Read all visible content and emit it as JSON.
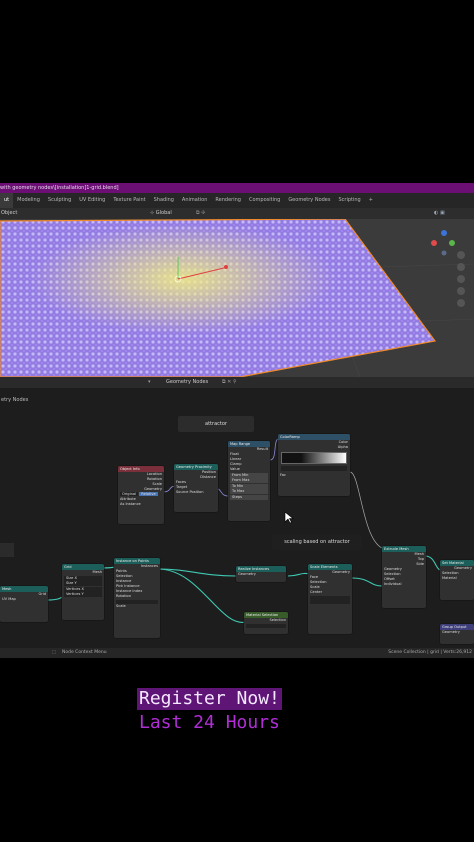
{
  "window": {
    "title": "with geometry nodes\\[installation]1-grid.blend]"
  },
  "tabs": [
    "ut",
    "Modeling",
    "Sculpting",
    "UV Editing",
    "Texture Paint",
    "Shading",
    "Animation",
    "Rendering",
    "Compositing",
    "Geometry Nodes",
    "Scripting",
    "+"
  ],
  "viewport_header": {
    "mode": "Object",
    "transform": "Global"
  },
  "node_editor_header": {
    "editor": "Geometry Nodes"
  },
  "node_tree": {
    "label": "etry Nodes",
    "frames": {
      "attractor": "attractor",
      "scaling": "scaling based on attractor"
    },
    "nodes": {
      "object_info": {
        "title": "Object Info",
        "rows": [
          "Location",
          "Rotation",
          "Scale",
          "Geometry"
        ],
        "buttons": [
          "Original",
          "Relative"
        ],
        "options": [
          "Attribute",
          "As Instance"
        ]
      },
      "geometry_proximity": {
        "title": "Geometry Proximity",
        "rows": [
          "Position",
          "Distance",
          "Faces",
          "Target",
          "Source Position"
        ]
      },
      "map_range": {
        "title": "Map Range",
        "rows": [
          "Result",
          "Float",
          "Linear",
          "Clamp",
          "Value"
        ],
        "fields": [
          "From Min",
          "From Max",
          "To Min",
          "To Max",
          "Steps"
        ]
      },
      "color_ramp": {
        "title": "ColorRamp",
        "rows": [
          "Color",
          "Alpha",
          "Fac"
        ]
      },
      "grid": {
        "title": "Grid",
        "rows": [
          "Mesh",
          "Size X",
          "Size Y",
          "Vertices X",
          "Vertices Y"
        ]
      },
      "grid_input": {
        "title": "Mesh",
        "rows": [
          "Grid",
          "UV Map"
        ]
      },
      "instance_on_points": {
        "title": "Instance on Points",
        "rows": [
          "Instances",
          "Points",
          "Selection",
          "Instance",
          "Pick Instance",
          "Instance Index",
          "Rotation",
          "Scale"
        ]
      },
      "realize_instances": {
        "title": "Realize Instances",
        "rows": [
          "Geometry"
        ]
      },
      "material_selection": {
        "title": "Material Selection",
        "rows": [
          "Selection"
        ]
      },
      "set_position": {
        "title": "Scale Elements",
        "rows": [
          "Geometry",
          "Selection",
          "Scale",
          "Center",
          "Face"
        ]
      },
      "extrude_mesh": {
        "title": "Extrude Mesh",
        "rows": [
          "Mesh",
          "Top",
          "Side",
          "Geometry",
          "Selection",
          "Offset",
          "Individual"
        ]
      },
      "group_output": {
        "title": "Group Output",
        "rows": [
          "Geometry"
        ]
      },
      "set_material": {
        "title": "Set Material",
        "rows": [
          "Geometry",
          "Selection",
          "Material"
        ]
      }
    }
  },
  "status_bar": {
    "left": "Node Context Menu",
    "right": "Scene Collection | grid | Verts:26,912"
  },
  "promo": {
    "line1": "Register Now!",
    "line2": "Last 24 Hours"
  },
  "colors": {
    "title_bar": "#6b0f74",
    "promo_bg": "#5e1576",
    "promo_line2": "#b12ed6",
    "grid_plane": "#a58cf2"
  }
}
